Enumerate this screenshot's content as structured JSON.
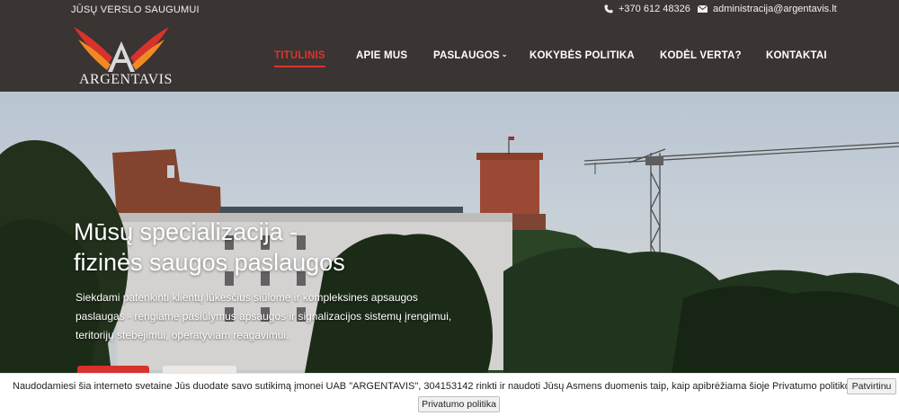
{
  "header": {
    "tagline": "JŪSŲ VERSLO SAUGUMUI",
    "phone": "+370 612 48326",
    "email": "administracija@argentavis.lt",
    "logo_text": "ARGENTAVIS",
    "icons": {
      "phone": "phone-icon",
      "email": "envelope-icon"
    }
  },
  "nav": {
    "items": [
      {
        "label": "TITULINIS",
        "active": true
      },
      {
        "label": "APIE MUS"
      },
      {
        "label": "PASLAUGOS",
        "has_dropdown": true
      },
      {
        "label": "KOKYBĖS POLITIKA"
      },
      {
        "label": "KODĖL VERTA?"
      },
      {
        "label": "KONTAKTAI"
      }
    ]
  },
  "hero": {
    "title_line1": "Mūsų specializacija -",
    "title_line2": "fizinės saugos paslaugos",
    "description": "Siekdami patenkinti klientų lūkesčius siūlome ir kompleksines apsaugos paslaugas - rengiame pasiūlymus apsaugos ir signalizacijos sistemų įrengimui, teritorijų stebėjimui, operatyviam reagavimui."
  },
  "cookie": {
    "text": "Naudodamiesi šia interneto svetaine Jūs duodate savo sutikimą įmonei UAB \"ARGENTAVIS\", 304153142 rinkti ir naudoti Jūsų Asmens duomenis taip, kaip apibrėžiama šioje Privatumo politikoje.",
    "confirm_label": "Patvirtinu",
    "privacy_label": "Privatumo politika"
  },
  "colors": {
    "header_bg": "#3a3433",
    "accent_red": "#e0322d",
    "logo_orange": "#f08a24",
    "logo_red": "#d8322c"
  }
}
